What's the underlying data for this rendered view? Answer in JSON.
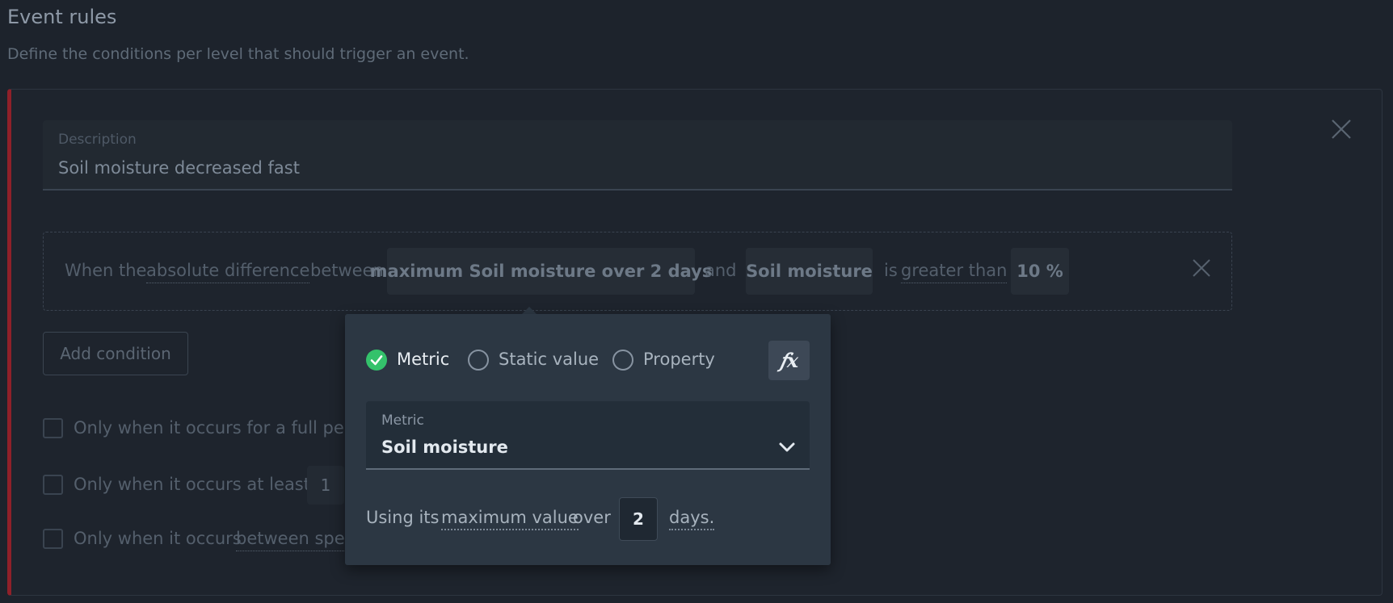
{
  "page": {
    "title": "Event rules",
    "subtitle": "Define the conditions per level that should trigger an event."
  },
  "rule": {
    "description_label": "Description",
    "description_value": "Soil moisture decreased fast",
    "condition": {
      "prefix": "When the",
      "function": "absolute difference",
      "between": "between",
      "operand_a": "maximum Soil moisture over 2 days",
      "and": "and",
      "operand_b": "Soil moisture",
      "is": "is",
      "comparator": "greater than",
      "threshold": "10 %"
    },
    "add_condition_label": "Add condition",
    "options": [
      {
        "pre": "Only when it occurs for a full peri",
        "checked": false
      },
      {
        "pre": "Only when it occurs at least",
        "count": "1",
        "checked": false
      },
      {
        "pre": "Only when it occurs",
        "link": "between spec",
        "checked": false
      }
    ]
  },
  "popup": {
    "types": [
      {
        "label": "Metric",
        "selected": true
      },
      {
        "label": "Static value",
        "selected": false
      },
      {
        "label": "Property",
        "selected": false
      }
    ],
    "fx_label": "𝑓x",
    "fx_icon": "function-icon",
    "metric_label": "Metric",
    "metric_value": "Soil moisture",
    "using_prefix": "Using its",
    "aggregate": "maximum value",
    "over": "over",
    "period_value": "2",
    "period_unit": "days."
  },
  "colors": {
    "background": "#1d232c",
    "accent_bar": "#8f2029",
    "radio_selected": "#34c26b",
    "popup_bg": "#2c3743"
  }
}
